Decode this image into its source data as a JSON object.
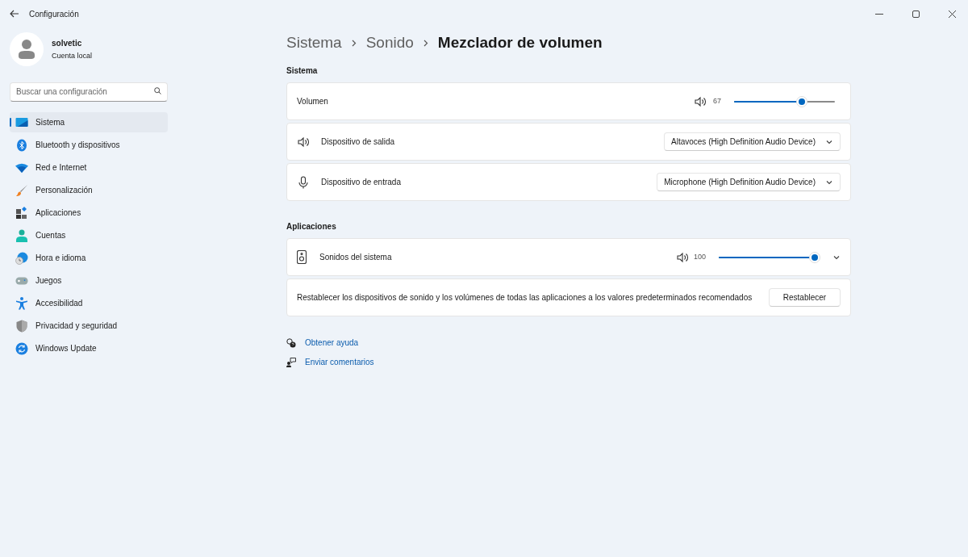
{
  "window": {
    "title": "Configuración"
  },
  "account": {
    "name": "solvetic",
    "type": "Cuenta local"
  },
  "search": {
    "placeholder": "Buscar una configuración"
  },
  "sidebar": {
    "items": [
      {
        "label": "Sistema",
        "selected": true
      },
      {
        "label": "Bluetooth y dispositivos",
        "selected": false
      },
      {
        "label": "Red e Internet",
        "selected": false
      },
      {
        "label": "Personalización",
        "selected": false
      },
      {
        "label": "Aplicaciones",
        "selected": false
      },
      {
        "label": "Cuentas",
        "selected": false
      },
      {
        "label": "Hora e idioma",
        "selected": false
      },
      {
        "label": "Juegos",
        "selected": false
      },
      {
        "label": "Accesibilidad",
        "selected": false
      },
      {
        "label": "Privacidad y seguridad",
        "selected": false
      },
      {
        "label": "Windows Update",
        "selected": false
      }
    ]
  },
  "breadcrumb": [
    "Sistema",
    "Sonido",
    "Mezclador de volumen"
  ],
  "system_section": {
    "heading": "Sistema",
    "volume": {
      "label": "Volumen",
      "reading": "67",
      "level": 0.67
    },
    "devices": [
      {
        "kind": "output",
        "label": "Dispositivo de salida",
        "value": "Altavoces (High Definition Audio Device)"
      },
      {
        "kind": "input",
        "label": "Dispositivo de entrada",
        "value": "Microphone (High Definition Audio Device)"
      }
    ]
  },
  "apps_section": {
    "heading": "Aplicaciones",
    "apps": [
      {
        "name": "Sonidos del sistema",
        "reading": "100",
        "level": 1.0,
        "expanded": false
      }
    ],
    "reset": {
      "text": "Restablecer los dispositivos de sonido y los volúmenes de todas las aplicaciones a los valores predeterminados recomendados",
      "button": "Restablecer"
    }
  },
  "links": [
    {
      "kind": "help",
      "label": "Obtener ayuda"
    },
    {
      "kind": "feedback",
      "label": "Enviar comentarios"
    }
  ]
}
